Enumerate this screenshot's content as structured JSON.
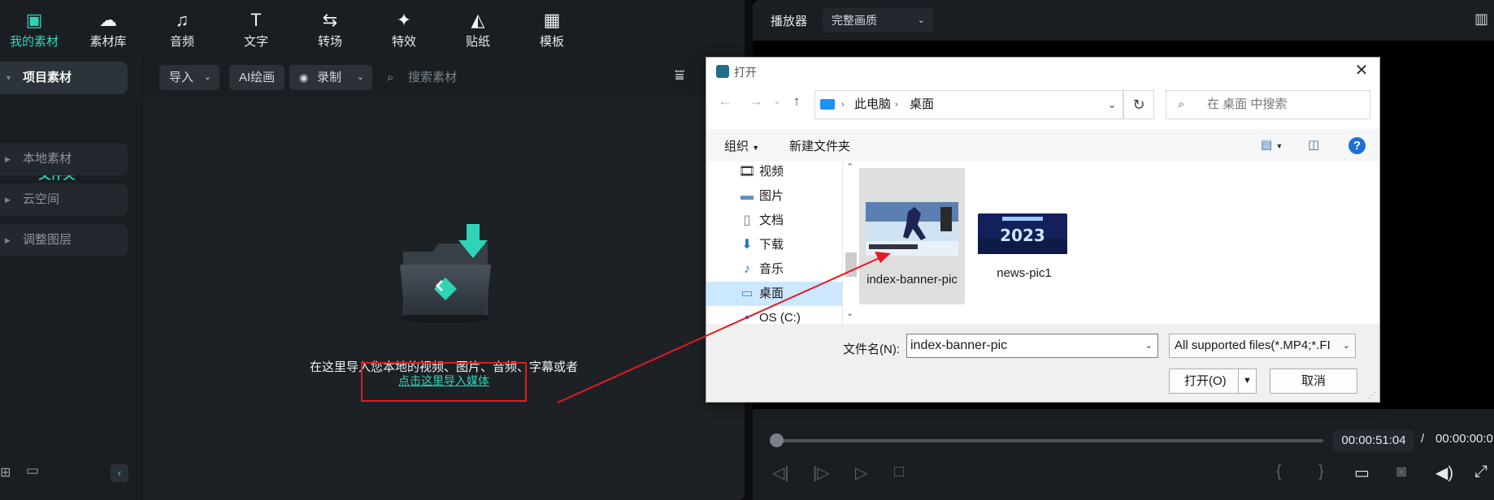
{
  "toolbar": {
    "items": [
      {
        "label": "我的素材",
        "icon": "media-icon",
        "active": true
      },
      {
        "label": "素材库",
        "icon": "library-icon"
      },
      {
        "label": "音频",
        "icon": "music-icon"
      },
      {
        "label": "文字",
        "icon": "text-icon"
      },
      {
        "label": "转场",
        "icon": "transition-icon"
      },
      {
        "label": "特效",
        "icon": "effects-icon"
      },
      {
        "label": "贴纸",
        "icon": "sticker-icon"
      },
      {
        "label": "模板",
        "icon": "template-icon"
      }
    ]
  },
  "sidebar": {
    "project_media": "项目素材",
    "folder": "文件夹",
    "local_media": "本地素材",
    "cloud": "云空间",
    "adjust_layer": "调整图层"
  },
  "media_toolbar": {
    "import": "导入",
    "ai_paint": "AI绘画",
    "record": "录制",
    "search_placeholder": "搜索素材"
  },
  "empty_state": {
    "text": "在这里导入您本地的视频、图片、音频、字幕或者",
    "link": "点击这里导入媒体"
  },
  "player": {
    "label": "播放器",
    "quality": "完整画质",
    "timecode": "00:00:51:04",
    "separator": "/",
    "total": "00:00:00:0",
    "progress": 0
  },
  "dialog": {
    "title": "打开",
    "breadcrumb": [
      "此电脑",
      "桌面"
    ],
    "search_placeholder": "在 桌面 中搜索",
    "organize": "组织",
    "new_folder": "新建文件夹",
    "nav": [
      {
        "label": "视频",
        "icon": "film-icon"
      },
      {
        "label": "图片",
        "icon": "picture-icon"
      },
      {
        "label": "文档",
        "icon": "document-icon"
      },
      {
        "label": "下载",
        "icon": "download-icon"
      },
      {
        "label": "音乐",
        "icon": "music-note-icon"
      },
      {
        "label": "桌面",
        "icon": "desktop-icon",
        "selected": true
      },
      {
        "label": "OS (C:)",
        "icon": "drive-icon"
      }
    ],
    "files": [
      {
        "name": "index-banner-pic",
        "selected": true
      },
      {
        "name": "news-pic1",
        "selected": false,
        "thumb_text": "2023"
      }
    ],
    "filename_label": "文件名(N):",
    "filename_value": "index-banner-pic",
    "filter_value": "All supported files(*.MP4;*.FI",
    "open": "打开(O)",
    "cancel": "取消"
  },
  "colors": {
    "accent": "#2ed4b8",
    "annotation": "#e5191f",
    "selection": "#cce8ff"
  }
}
